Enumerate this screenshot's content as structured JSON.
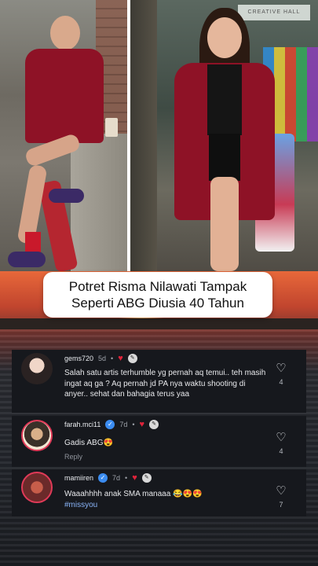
{
  "scene": {
    "sign_text": "CREATIVE HALL",
    "caption": "Potret Risma Nilawati Tampak Seperti ABG Diusia 40 Tahun"
  },
  "comments": [
    {
      "username": "gems720",
      "time": "5d",
      "separator": "•",
      "verified": false,
      "text": "Salah satu artis terhumble yg pernah aq temui.. teh masih ingat aq ga ? Aq pernah jd PA nya waktu shooting di anyer.. sehat dan bahagia terus yaa",
      "likes": "4",
      "reply_label": ""
    },
    {
      "username": "farah.mci11",
      "time": "7d",
      "separator": "•",
      "verified": true,
      "text": "Gadis ABG😍",
      "likes": "4",
      "reply_label": "Reply"
    },
    {
      "username": "mamiiren",
      "time": "7d",
      "separator": "•",
      "verified": true,
      "text": "Waaahhhh anak SMA manaaa 😂😍😍",
      "hashtag": "#missyou",
      "likes": "7",
      "reply_label": ""
    }
  ],
  "icons": {
    "heart_liked": "♥",
    "heart_outline": "♡",
    "verified_check": "✓",
    "creator_badge": "✎"
  },
  "colors": {
    "jacket_red": "#8e1226",
    "comment_bg": "#16181d",
    "heart_red": "#e0233a",
    "verified_blue": "#3b8cf0",
    "hashtag_blue": "#8ab4f8"
  }
}
